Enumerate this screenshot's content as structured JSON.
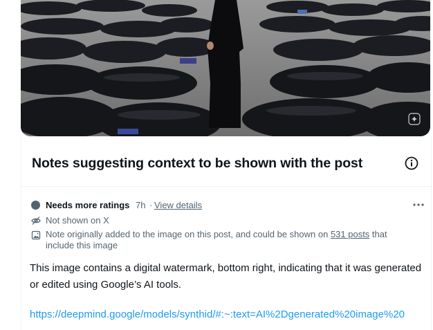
{
  "media": {
    "alt_scene": "photo",
    "icons": {
      "watermark": "gemini-sparkle-icon"
    }
  },
  "notes": {
    "title": "Notes suggesting context to be shown with the post",
    "info_icon": "info-circle-icon",
    "note": {
      "status": "Needs more ratings",
      "time": "7h",
      "separator": "·",
      "view_details": "View details",
      "more_icon": "more-horizontal-icon",
      "not_shown": "Not shown on X",
      "media_note_prefix": "Note originally added to the image on this post, and could be shown on ",
      "media_note_count": "531 posts",
      "media_note_suffix": " that include this image",
      "body": "This image contains a digital watermark, bottom right, indicating that it was generated or edited using Google’s AI tools.",
      "link": "https://deepmind.google/models/synthid/#:~:text=AI%2Dgenerated%20image%20"
    }
  },
  "colors": {
    "text_primary": "#0f1419",
    "text_secondary": "#536471",
    "link": "#1d9bf0",
    "border": "#eff3f4"
  }
}
